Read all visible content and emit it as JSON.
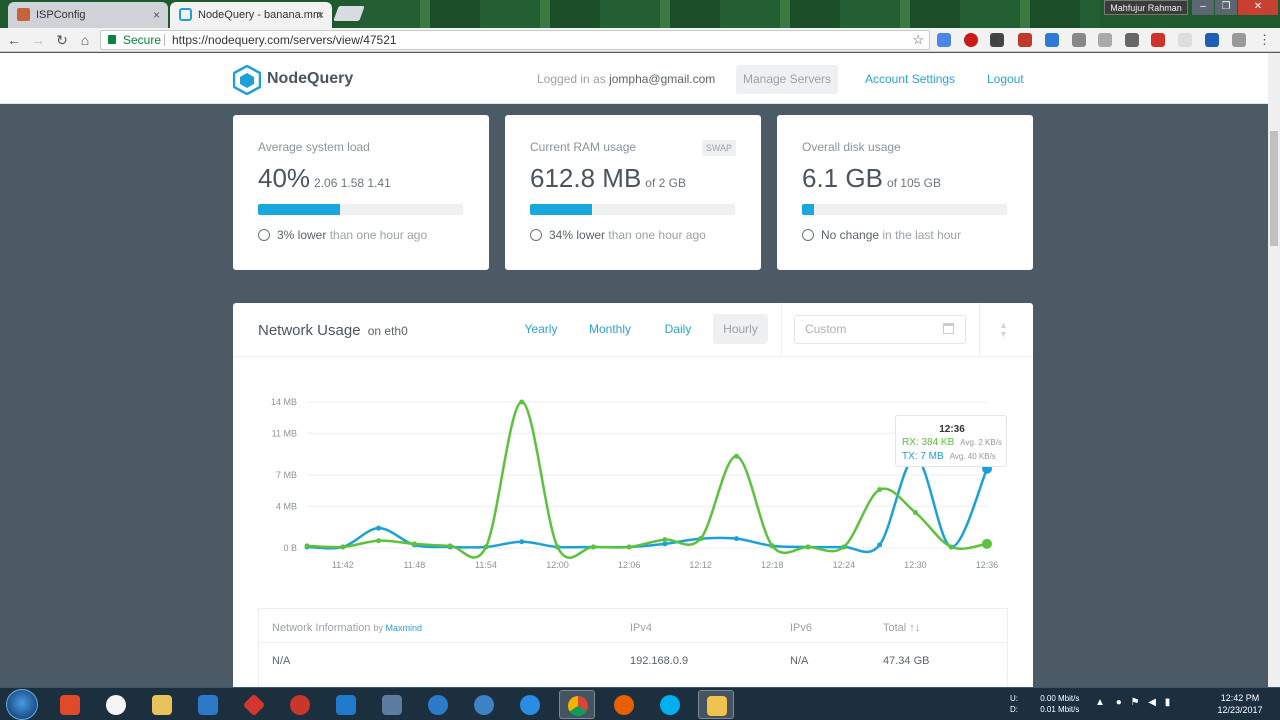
{
  "browser": {
    "tabs": [
      {
        "title": "ISPConfig",
        "close": "×"
      },
      {
        "title": "NodeQuery - banana.mm",
        "close": "×"
      }
    ],
    "window_user": "Mahfujur Rahman",
    "window_buttons": [
      "–",
      "❐",
      "✕"
    ],
    "nav": {
      "back": "←",
      "forward": "→",
      "reload": "↻",
      "home": "⌂"
    },
    "secure_label": "Secure",
    "url": "https://nodequery.com/servers/view/47521",
    "star": "☆"
  },
  "header": {
    "brand": "NodeQuery",
    "logged_in_prefix": "Logged in as",
    "user_email": "jompha@gmail.com",
    "manage_servers": "Manage Servers",
    "account_settings": "Account Settings",
    "logout": "Logout"
  },
  "cards": {
    "load": {
      "title": "Average system load",
      "value": "40%",
      "sub": "2.06 1.58 1.41",
      "fill": 0.4,
      "foot_bold": "3% lower",
      "foot_rest": "than one hour ago"
    },
    "ram": {
      "title": "Current RAM usage",
      "badge": "SWAP",
      "value": "612.8 MB",
      "sub": "of 2 GB",
      "fill": 0.3,
      "foot_bold": "34% lower",
      "foot_rest": "than one hour ago"
    },
    "disk": {
      "title": "Overall disk usage",
      "value": "6.1 GB",
      "sub": "of 105 GB",
      "fill": 0.058,
      "foot_bold": "No change",
      "foot_rest": "in the last hour"
    }
  },
  "network": {
    "title": "Network Usage",
    "interface": "on eth0",
    "ranges": [
      "Yearly",
      "Monthly",
      "Daily",
      "Hourly"
    ],
    "selected_range": "Hourly",
    "custom_placeholder": "Custom",
    "tooltip": {
      "time": "12:36",
      "rx": "RX: 384 KB",
      "rx_avg": "Avg. 2 KB/s",
      "tx": "TX: 7 MB",
      "tx_avg": "Avg. 40 KB/s"
    },
    "table": {
      "headers": {
        "info": "Network Information",
        "by": "by",
        "provider": "Maxmind",
        "ipv4": "IPv4",
        "ipv6": "IPv6",
        "total": "Total ↑↓"
      },
      "row": {
        "info": "N/A",
        "ipv4": "192.168.0.9",
        "ipv6": "N/A",
        "total": "47.34 GB"
      }
    }
  },
  "chart_data": {
    "type": "line",
    "x": [
      "11:39",
      "11:42",
      "11:45",
      "11:48",
      "11:51",
      "11:54",
      "11:57",
      "12:00",
      "12:03",
      "12:06",
      "12:09",
      "12:12",
      "12:15",
      "12:18",
      "12:21",
      "12:24",
      "12:27",
      "12:30",
      "12:33",
      "12:36"
    ],
    "x_tick_labels": [
      "11:42",
      "11:48",
      "11:54",
      "12:00",
      "12:06",
      "12:12",
      "12:18",
      "12:24",
      "12:30",
      "12:36"
    ],
    "y_tick_labels": [
      "0 B",
      "4 MB",
      "7 MB",
      "11 MB",
      "14 MB"
    ],
    "y_ticks": [
      0,
      4,
      7,
      11,
      14
    ],
    "ylim": [
      0,
      14
    ],
    "y_unit": "MB",
    "series": [
      {
        "name": "RX",
        "color": "#5cc23c",
        "values": [
          0.2,
          0.1,
          0.7,
          0.4,
          0.2,
          0.1,
          14,
          0.1,
          0.1,
          0.1,
          0.8,
          0.9,
          8.8,
          0.2,
          0.1,
          0.1,
          5.6,
          3.4,
          0.1,
          0.4
        ]
      },
      {
        "name": "TX",
        "color": "#1ba1d8",
        "values": [
          0.1,
          0.1,
          1.9,
          0.3,
          0.1,
          0.1,
          0.6,
          0.1,
          0.1,
          0.1,
          0.4,
          0.9,
          0.9,
          0.2,
          0.1,
          0.1,
          0.3,
          8.7,
          0.1,
          7.6
        ]
      }
    ],
    "grid": true
  },
  "taskbar": {
    "net_up": "0.00 Mbit/s",
    "net_down": "0.01 Mbit/s",
    "net_up_label": "U:",
    "net_down_label": "D:",
    "time": "12:42 PM",
    "date": "12/23/2017"
  },
  "colors": {
    "accent": "#2ba3d4",
    "bar": "#19a8de",
    "rx": "#5cc23c",
    "tx": "#1ba1d8",
    "background": "#4c5a66"
  }
}
